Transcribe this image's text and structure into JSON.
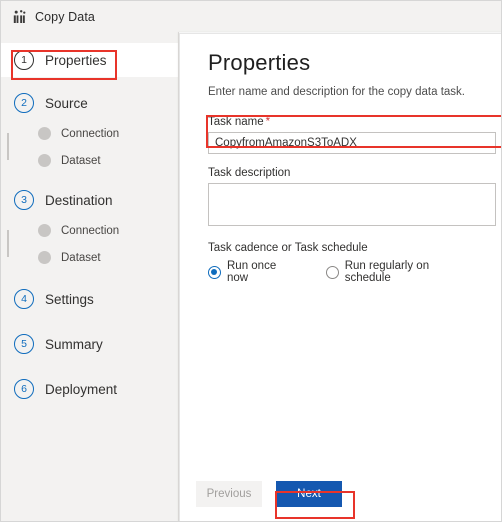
{
  "window": {
    "title": "Copy Data",
    "icon": "copy-data-icon"
  },
  "colors": {
    "accent": "#0f6cbd",
    "primary_button": "#1558b0",
    "highlight": "#e8342a",
    "rail_bg": "#f3f2f1",
    "required_star": "#d13438"
  },
  "sidebar": {
    "steps": [
      {
        "num": "1",
        "label": "Properties",
        "active": true,
        "substeps": []
      },
      {
        "num": "2",
        "label": "Source",
        "active": false,
        "substeps": [
          "Connection",
          "Dataset"
        ]
      },
      {
        "num": "3",
        "label": "Destination",
        "active": false,
        "substeps": [
          "Connection",
          "Dataset"
        ]
      },
      {
        "num": "4",
        "label": "Settings",
        "active": false,
        "substeps": []
      },
      {
        "num": "5",
        "label": "Summary",
        "active": false,
        "substeps": []
      },
      {
        "num": "6",
        "label": "Deployment",
        "active": false,
        "substeps": []
      }
    ]
  },
  "main": {
    "title": "Properties",
    "subtitle": "Enter name and description for the copy data task.",
    "task_name": {
      "label": "Task name",
      "required_marker": "*",
      "value": "CopyfromAmazonS3ToADX",
      "placeholder": ""
    },
    "task_description": {
      "label": "Task description",
      "value": "",
      "placeholder": ""
    },
    "cadence": {
      "label": "Task cadence or Task schedule",
      "options": [
        {
          "label": "Run once now",
          "selected": true
        },
        {
          "label": "Run regularly on schedule",
          "selected": false
        }
      ]
    }
  },
  "footer": {
    "previous_label": "Previous",
    "next_label": "Next"
  }
}
